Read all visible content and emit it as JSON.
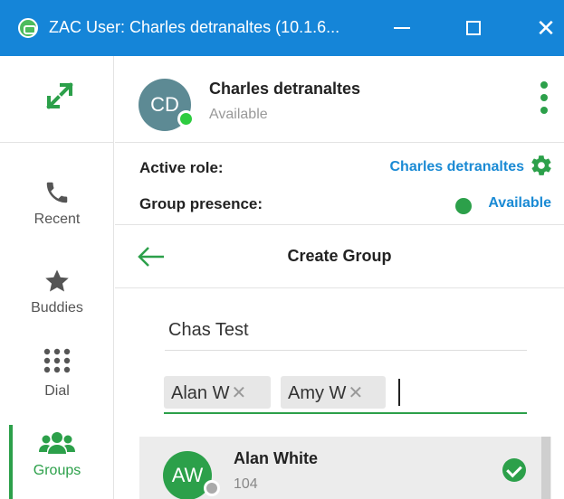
{
  "window": {
    "title": "ZAC User: Charles detranaltes (10.1.6...",
    "minimize_icon": "minimize-icon",
    "maximize_icon": "maximize-icon",
    "close_glyph": "✕"
  },
  "colors": {
    "titlebar": "#1585d8",
    "accent_green": "#2ca04a",
    "link_blue": "#1a8ad4",
    "avatar_gray": "#5d8a94"
  },
  "rail": {
    "items": [
      {
        "label": "Recent",
        "icon": "phone-icon"
      },
      {
        "label": "Buddies",
        "icon": "star-icon"
      },
      {
        "label": "Dial",
        "icon": "dialpad-icon"
      },
      {
        "label": "Groups",
        "icon": "groups-icon",
        "active": true
      }
    ]
  },
  "header": {
    "avatar_initials": "CD",
    "name": "Charles detranaltes",
    "status": "Available"
  },
  "role": {
    "active_label": "Active role:",
    "active_value": "Charles detranaltes",
    "presence_label": "Group presence:",
    "presence_value": "Available"
  },
  "create_group": {
    "title": "Create Group",
    "group_name": "Chas Test",
    "chips": [
      "Alan W",
      "Amy W"
    ],
    "chip_remove": "✕"
  },
  "list": {
    "items": [
      {
        "initials": "AW",
        "name": "Alan White",
        "ext": "104",
        "selected": true
      }
    ]
  }
}
